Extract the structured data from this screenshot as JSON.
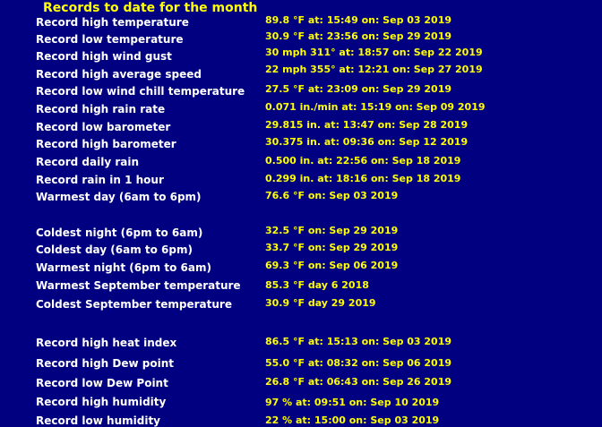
{
  "title": "Records to date for the month",
  "records": [
    {
      "label": "Record high temperature",
      "value": "89.8 °F   at: 15:49 on: Sep 03 2019"
    },
    {
      "label": "Record low temperature",
      "value": "30.9 °F   at: 23:56 on: Sep 29 2019"
    },
    {
      "label": "Record high wind gust",
      "value": "30 mph 311°  at: 18:57 on: Sep 22 2019"
    },
    {
      "label": "Record high average speed",
      "value": "22 mph 355°  at:  12:21 on: Sep 27 2019"
    },
    {
      "label": "Record low wind chill temperature",
      "value": "27.5 °F at: 23:09 on: Sep 29 2019"
    },
    {
      "label": "Record high rain rate",
      "value": "0.071 in./min   at: 15:19 on: Sep 09 2019"
    },
    {
      "label": "Record low barometer",
      "value": "29.815 in.  at: 13:47 on: Sep 28 2019"
    },
    {
      "label": "Record high barometer",
      "value": "30.375 in.  at: 09:36 on: Sep 12 2019"
    },
    {
      "label": "Record daily rain",
      "value": "0.500 in.  at: 22:56 on: Sep 18 2019"
    },
    {
      "label": "Record rain in 1 hour",
      "value": "0.299 in. at: 18:16 on: Sep 18 2019"
    },
    {
      "label": "Warmest day (6am to 6pm)",
      "value": "76.6 °F   on: Sep 03 2019"
    },
    {
      "label": "Coldest night (6pm to 6am)",
      "value": "32.5 °F   on: Sep 29 2019"
    },
    {
      "label": "Coldest day (6am to 6pm)",
      "value": "33.7 °F   on: Sep 29 2019"
    },
    {
      "label": "Warmest night (6pm to 6am)",
      "value": "69.3 °F   on: Sep 06 2019"
    },
    {
      "label": "Warmest September temperature",
      "value": "85.3 °F day 6 2018"
    },
    {
      "label": "Coldest September temperature",
      "value": "30.9 °F day 29 2019"
    },
    {
      "label": "Record high heat index",
      "value": "86.5 °F   at: 15:13 on: Sep 03 2019"
    },
    {
      "label": "Record high Dew point",
      "value": "55.0 °F   at: 08:32 on: Sep 06 2019"
    },
    {
      "label": "Record low Dew Point",
      "value": "26.8 °F   at: 06:43 on: Sep 26 2019"
    },
    {
      "label": "Record high humidity",
      "value": "97 %   at: 09:51 on: Sep 10 2019"
    },
    {
      "label": "Record low humidity",
      "value": "22 %   at: 15:00 on: Sep 03 2019"
    }
  ]
}
